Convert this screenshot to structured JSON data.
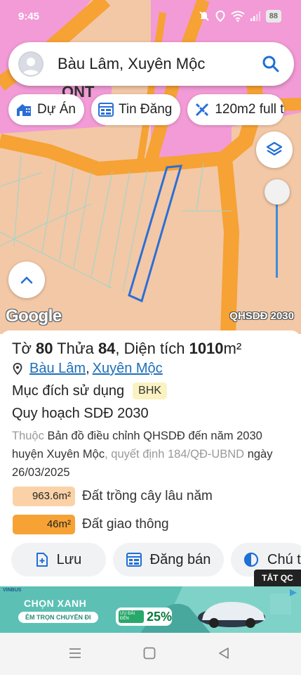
{
  "status_bar": {
    "time": "9:45",
    "battery": "88",
    "icons": [
      "bell-off-icon",
      "location-icon",
      "wifi-icon",
      "signal-icon",
      "battery-icon"
    ]
  },
  "map": {
    "google_logo": "Google",
    "layer_name": "QHSDĐ 2030",
    "map_label": "ONT"
  },
  "search": {
    "value": "Bàu Lâm, Xuyên Mộc",
    "icon": "search-icon"
  },
  "chips": [
    {
      "label": "Dự Án",
      "icon": "home-icon"
    },
    {
      "label": "Tin Đăng",
      "icon": "listing-icon"
    },
    {
      "label": "120m2 full t",
      "icon": "ruler-icon"
    }
  ],
  "parcel": {
    "title_prefix": "Tờ ",
    "sheet": "80",
    "title_mid": " Thửa ",
    "plot": "84",
    "title_area_label": ", Diện tích ",
    "area": "1010",
    "area_unit": "m²",
    "commune": "Bàu Lâm",
    "district": "Xuyên Mộc",
    "purpose_label": "Mục đích sử dụng",
    "purpose_code": "BHK",
    "plan_label": "Quy hoạch SDĐ 2030",
    "desc_prefix": "Thuộc ",
    "desc_main": "Bản đồ điều chỉnh QHSDĐ đến năm 2030 huyện Xuyên Mộc",
    "desc_mid": ", quyết định 184/QĐ-UBND ",
    "desc_date": "ngày 26/03/2025",
    "land_uses": [
      {
        "area": "963.6m²",
        "label": "Đất trồng cây lâu năm",
        "color": "#fbd2a7"
      },
      {
        "area": "46m²",
        "label": "Đất giao thông",
        "color": "#f6a234"
      }
    ]
  },
  "actions": {
    "save": "Lưu",
    "sell": "Đăng bán",
    "note": "Chú t"
  },
  "ad": {
    "tag": "TẮT QC",
    "brand": "VINBUS",
    "headline": "CHỌN XANH",
    "subline": "ÊM TRỌN CHUYẾN ĐI",
    "promo_small": "ƯU ĐÃI ĐẾN",
    "promo_pct": "25%"
  },
  "colors": {
    "map_base": "#f2c8a6",
    "road": "#f6a234",
    "residential": "#f29bd6",
    "parcel_outline": "#2b6fd6",
    "link": "#1e6fb8",
    "slider": "#3d8bdb"
  }
}
